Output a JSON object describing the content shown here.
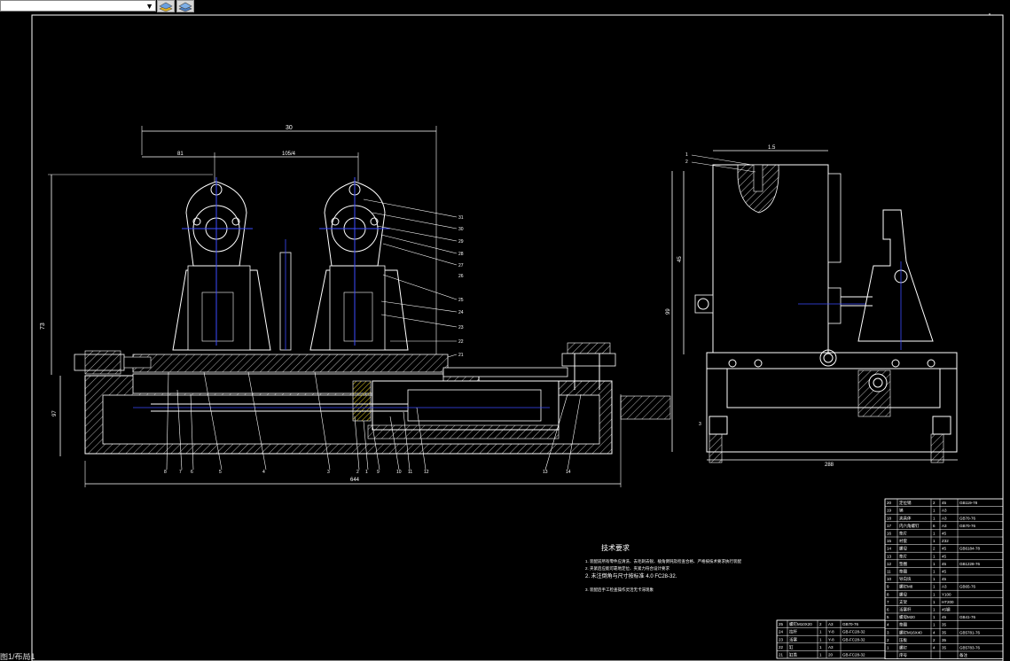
{
  "toolbar": {
    "layer_dropdown_value": "",
    "icons": [
      "layer-states-icon",
      "layer-previous-icon"
    ]
  },
  "drawing": {
    "dims": {
      "overall_width": "30",
      "left_pitch": "81",
      "center_pitch": "105/4",
      "height_left": "73",
      "base_height": "97",
      "base_length": "644",
      "side_width": "1.5",
      "side_height": "45",
      "side_height2": "99",
      "side_base": "288"
    },
    "tech_requirements": {
      "title": "技术要求",
      "lines": [
        "1. 装配前所有零件应清洗、去毛刺去锐、棱角倒钝及检查合格、严格按技术要求执行装配",
        "2. 夹紧后应能可靠地定位、夹紧力符合设计要求",
        "2. 未注倒角与尺寸按标准 4.0 FC28-32.",
        "3. 装配后手工检查操作灵活无卡滞现象"
      ]
    },
    "leader_labels_top": [
      "31",
      "30",
      "29",
      "28",
      "27",
      "26",
      "25",
      "24",
      "23",
      "22",
      "21"
    ],
    "leader_labels_bottom": [
      "8",
      "7",
      "6",
      "5",
      "4",
      "3",
      "2",
      "1",
      "9",
      "10",
      "11",
      "12",
      "13",
      "14",
      "15",
      "16",
      "17"
    ],
    "side_labels": [
      "1",
      "2",
      "3"
    ]
  },
  "parts_table": {
    "rows": [
      {
        "no": "20",
        "name": "定位销",
        "qty": "2",
        "mat": "45",
        "std": "GB119-78"
      },
      {
        "no": "19",
        "name": "销",
        "qty": "1",
        "mat": "A3",
        "std": ""
      },
      {
        "no": "18",
        "name": "夹具体",
        "qty": "1",
        "mat": "A3",
        "std": "GB70-76"
      },
      {
        "no": "17",
        "name": "内六角螺钉",
        "qty": "6",
        "mat": "A3",
        "std": "GB70-76"
      },
      {
        "no": "16",
        "name": "垫片",
        "qty": "1",
        "mat": "45",
        "std": ""
      },
      {
        "no": "15",
        "name": "衬套",
        "qty": "1",
        "mat": "Z32",
        "std": ""
      },
      {
        "no": "14",
        "name": "螺母",
        "qty": "2",
        "mat": "45",
        "std": "GB6184-78"
      },
      {
        "no": "13",
        "name": "垫片",
        "qty": "1",
        "mat": "45",
        "std": ""
      },
      {
        "no": "12",
        "name": "垫圈",
        "qty": "1",
        "mat": "45",
        "std": "GB1228-76"
      },
      {
        "no": "11",
        "name": "垫圈",
        "qty": "1",
        "mat": "45",
        "std": ""
      },
      {
        "no": "10",
        "name": "导向块",
        "qty": "1",
        "mat": "45",
        "std": ""
      },
      {
        "no": "9",
        "name": "螺钉M8",
        "qty": "1",
        "mat": "A3",
        "std": "GB65-76"
      },
      {
        "no": "8",
        "name": "螺母",
        "qty": "1",
        "mat": "Y100",
        "std": ""
      },
      {
        "no": "7",
        "name": "支架",
        "qty": "1",
        "mat": "HT200",
        "std": ""
      },
      {
        "no": "6",
        "name": "活塞杆",
        "qty": "1",
        "mat": "45钢",
        "std": ""
      },
      {
        "no": "5",
        "name": "螺母M20",
        "qty": "1",
        "mat": "45",
        "std": "GB41-76"
      },
      {
        "no": "4",
        "name": "垫圈",
        "qty": "1",
        "mat": "35",
        "std": ""
      },
      {
        "no": "3",
        "name": "螺钉M16X40",
        "qty": "4",
        "mat": "35",
        "std": "GB5781-76"
      },
      {
        "no": "2",
        "name": "压板",
        "qty": "2",
        "mat": "35",
        "std": ""
      },
      {
        "no": "1",
        "name": "螺钉",
        "qty": "4",
        "mat": "35",
        "std": "GB5783-76"
      },
      {
        "no": "",
        "name": "序号",
        "qty": "",
        "mat": "",
        "std": "备注"
      }
    ],
    "left_rows": [
      {
        "no": "25",
        "name": "螺钉M10X20",
        "qty": "2",
        "mat": "A3",
        "std": "GB70-76"
      },
      {
        "no": "24",
        "name": "拉杆",
        "qty": "1",
        "mat": "Y-8",
        "std": "GB-FC28-32"
      },
      {
        "no": "23",
        "name": "活塞",
        "qty": "1",
        "mat": "Y-8",
        "std": "GB-FC28-32"
      },
      {
        "no": "22",
        "name": "缸",
        "qty": "1",
        "mat": "A3",
        "std": ""
      },
      {
        "no": "21",
        "name": "缸盖",
        "qty": "1",
        "mat": "20",
        "std": "GB-FC28-32"
      }
    ]
  },
  "status_text": "图1/布局1"
}
